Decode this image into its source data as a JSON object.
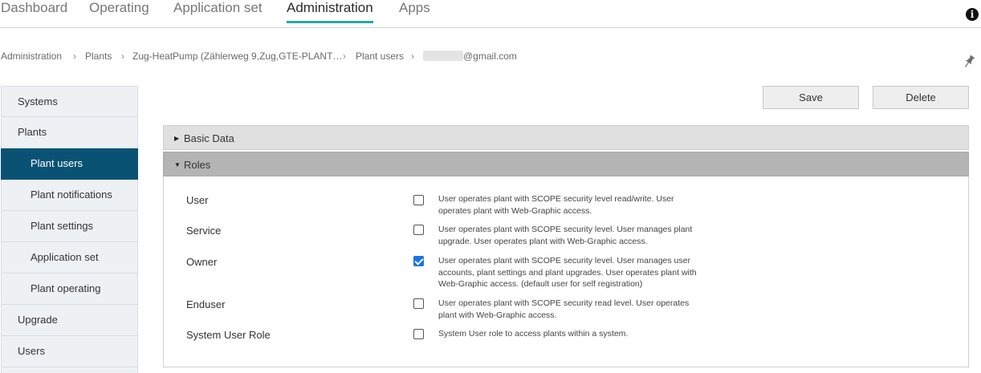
{
  "topnav": {
    "tabs": [
      {
        "label": "Dashboard",
        "active": false
      },
      {
        "label": "Operating",
        "active": false
      },
      {
        "label": "Application set",
        "active": false
      },
      {
        "label": "Administration",
        "active": true
      },
      {
        "label": "Apps",
        "active": false
      }
    ],
    "info_icon": "i",
    "accent_color": "#2aa8a0"
  },
  "breadcrumb": {
    "items": [
      "Administration",
      "Plants",
      "Zug-HeatPump (Zählerweg 9,Zug,GTE-PLANT…",
      "Plant users",
      "@gmail.com"
    ],
    "separator": "›"
  },
  "sidebar": {
    "active_color": "#0a5274",
    "items": [
      {
        "label": "Systems",
        "sub": false,
        "active": false
      },
      {
        "label": "Plants",
        "sub": false,
        "active": false
      },
      {
        "label": "Plant users",
        "sub": true,
        "active": true
      },
      {
        "label": "Plant notifications",
        "sub": true,
        "active": false
      },
      {
        "label": "Plant settings",
        "sub": true,
        "active": false
      },
      {
        "label": "Application set",
        "sub": true,
        "active": false
      },
      {
        "label": "Plant operating",
        "sub": true,
        "active": false
      },
      {
        "label": "Upgrade",
        "sub": false,
        "active": false
      },
      {
        "label": "Users",
        "sub": false,
        "active": false
      }
    ]
  },
  "actions": {
    "save_label": "Save",
    "delete_label": "Delete"
  },
  "panels": {
    "basic_data": {
      "title": "Basic Data",
      "expanded": false
    },
    "roles": {
      "title": "Roles",
      "expanded": true
    }
  },
  "roles": [
    {
      "label": "User",
      "checked": false,
      "desc": "User operates plant with SCOPE security level read/write. User operates plant with Web-Graphic access."
    },
    {
      "label": "Service",
      "checked": false,
      "desc": "User operates plant with SCOPE security level. User manages plant upgrade. User operates plant with Web-Graphic access."
    },
    {
      "label": "Owner",
      "checked": true,
      "desc": "User operates plant with SCOPE security level. User manages user accounts, plant settings and plant upgrades. User operates plant with Web-Graphic access. (default user for self registration)"
    },
    {
      "label": "Enduser",
      "checked": false,
      "desc": "User operates plant with SCOPE security read level. User operates plant with Web-Graphic access."
    },
    {
      "label": "System User Role",
      "checked": false,
      "desc": "System User role to access plants within a system."
    }
  ]
}
